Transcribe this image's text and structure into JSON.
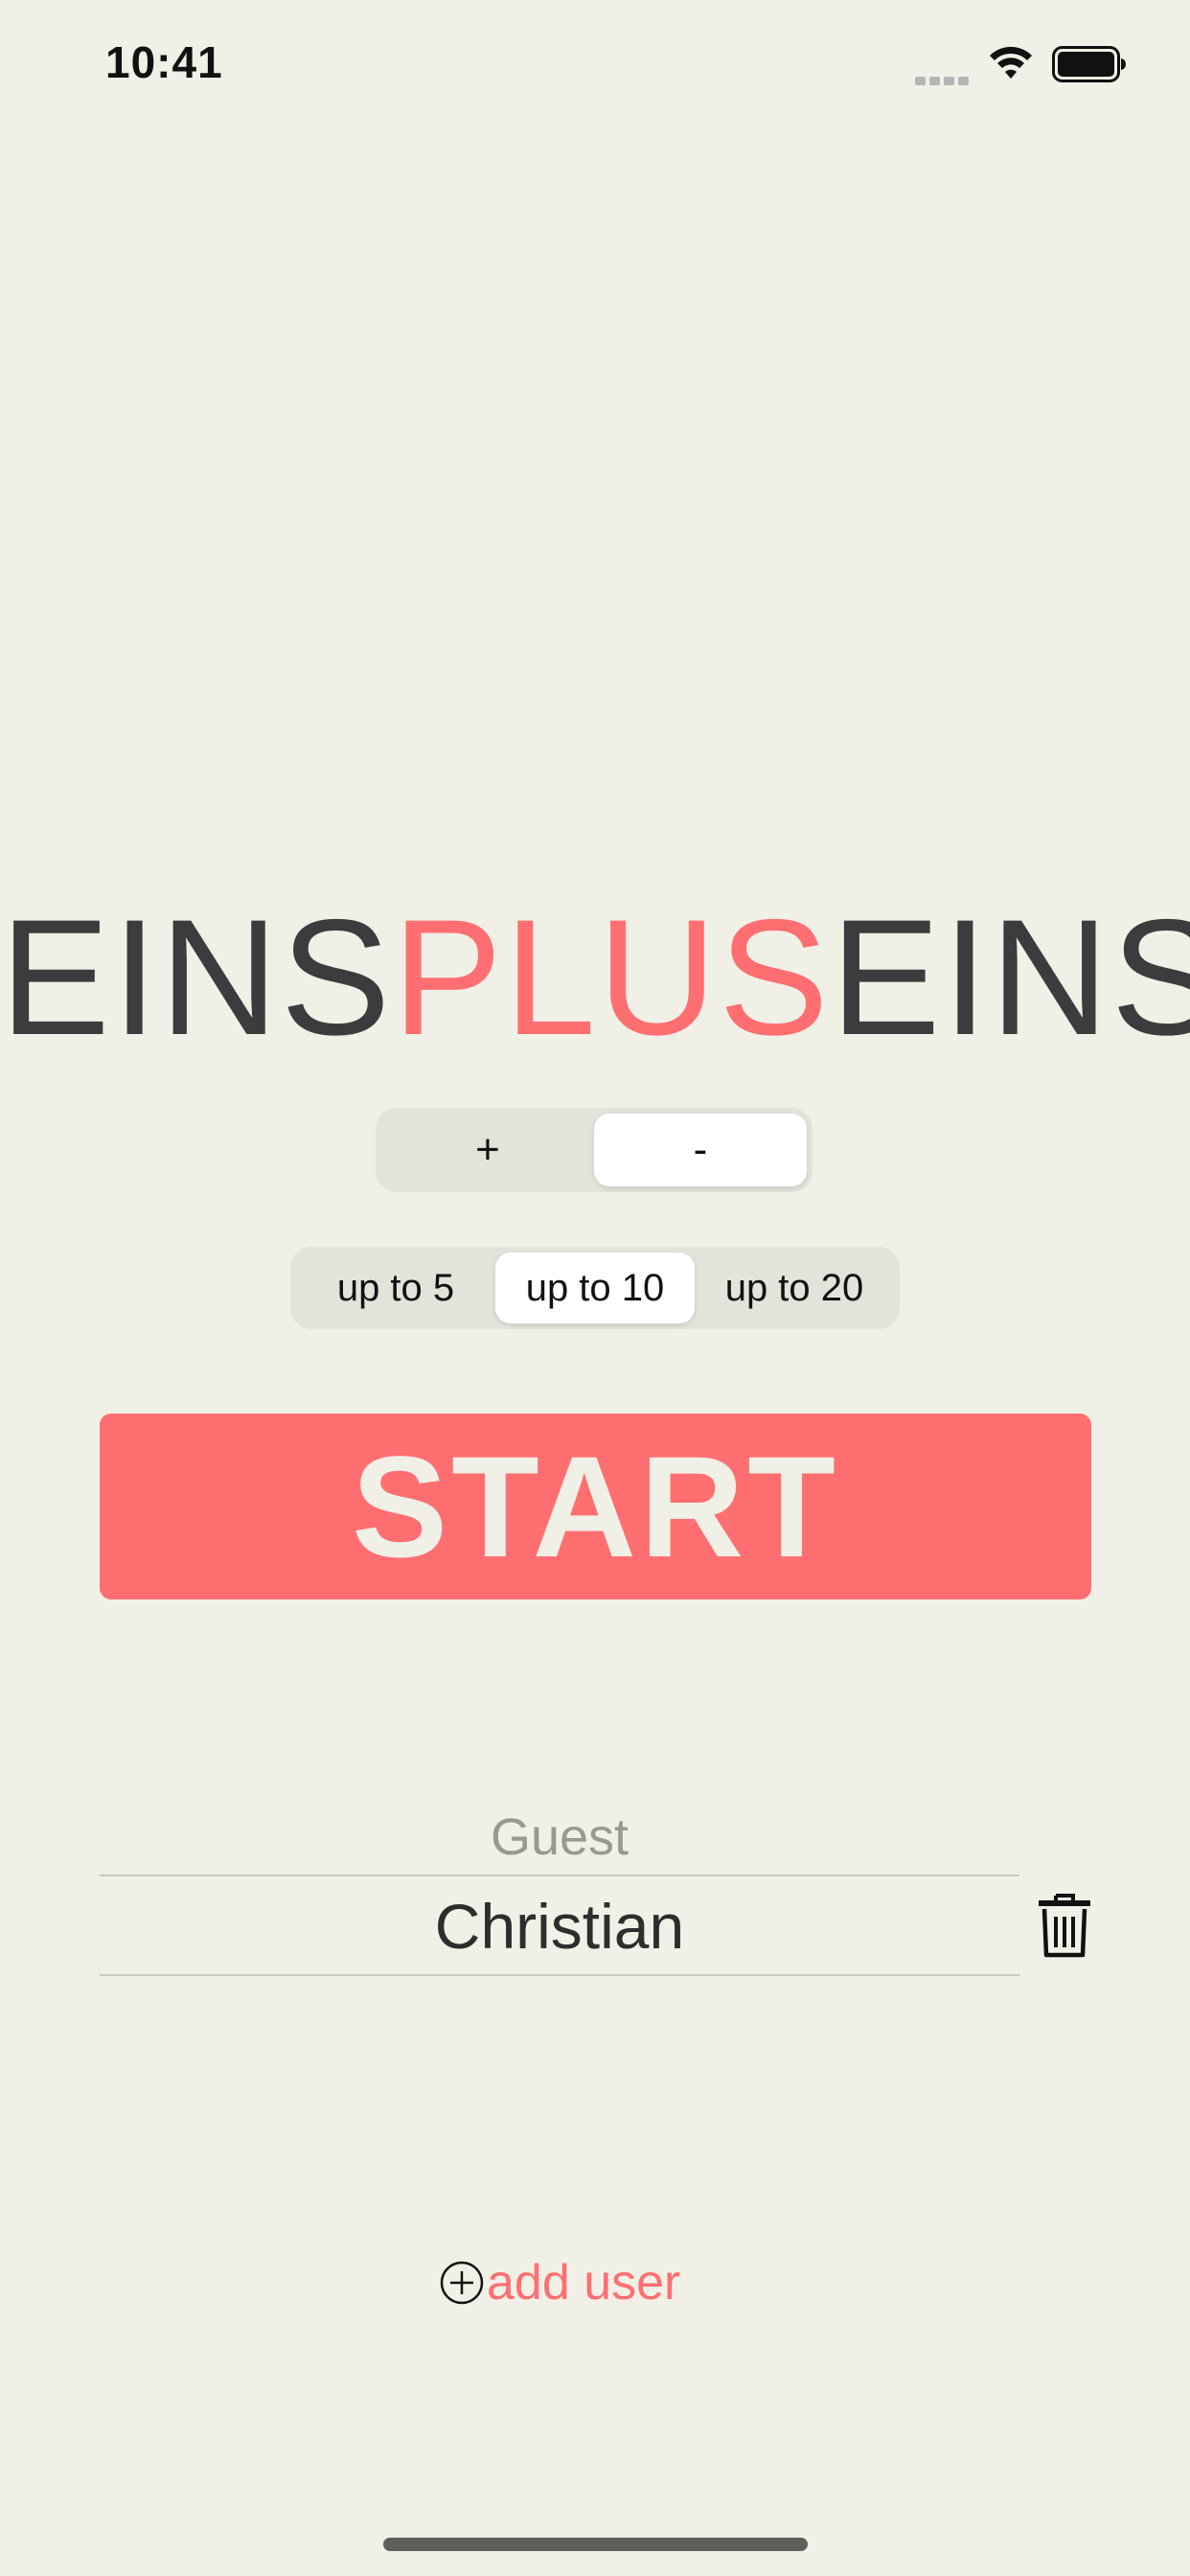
{
  "status_bar": {
    "time": "10:41",
    "icons": [
      "signal-icon",
      "wifi-icon",
      "battery-icon"
    ]
  },
  "title": {
    "part1": "EINS",
    "part2": "PLUS",
    "part3": "EINS"
  },
  "operation_selector": {
    "options": [
      "+",
      "-"
    ],
    "selected": "-"
  },
  "range_selector": {
    "options": [
      "up to 5",
      "up to 10",
      "up to 20"
    ],
    "selected": "up to 10"
  },
  "start_button": {
    "label": "START"
  },
  "users": {
    "items": [
      {
        "name": "Guest"
      },
      {
        "name": "Christian"
      }
    ]
  },
  "add_user": {
    "label": "add user"
  },
  "colors": {
    "background": "#f1f0e6",
    "accent": "#ff6f72",
    "title_dark": "#3c3c3e"
  }
}
